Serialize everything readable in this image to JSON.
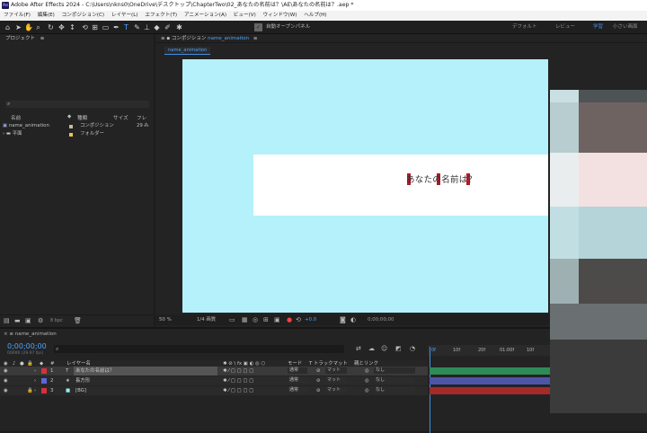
{
  "titlebar": {
    "icon_text": "Ae",
    "title": "Adobe After Effects 2024 - C:\\Users\\nkns0\\OneDrive\\デスクトップ\\ChapterTwo\\02_あなたの名前は？\\AE\\あなたの名前は？.aep *"
  },
  "menu": [
    "ファイル(F)",
    "編集(E)",
    "コンポジション(C)",
    "レイヤー(L)",
    "エフェクト(T)",
    "アニメーション(A)",
    "ビュー(V)",
    "ウィンドウ(W)",
    "ヘルプ(H)"
  ],
  "toolbar": {
    "auto_open_label": "自動オープンパネル",
    "workspaces": [
      "デフォルト",
      "レビュー",
      "学習",
      "小さい画面"
    ],
    "active_workspace": "学習"
  },
  "project": {
    "title": "プロジェクト",
    "columns": {
      "name": "名前",
      "type": "種類",
      "size": "サイズ",
      "fr": "フレ"
    },
    "items": [
      {
        "name": "name_animation",
        "type": "コンポジション",
        "size": "29",
        "color": "#c8b89a"
      },
      {
        "name": "平面",
        "type": "フォルダー",
        "size": "",
        "color": "#e8c84a"
      }
    ],
    "bpc": "8 bpc"
  },
  "comp": {
    "panel_title": "コンポジション",
    "comp_name": "name_animation",
    "tab": "name_animation",
    "text": "あなたの名前は？",
    "footer": {
      "zoom": "50 %",
      "resolution": "1/4 画質",
      "exposure": "+0.0",
      "timecode": "0;00;00;00"
    },
    "bg_color": "#b4f1fb"
  },
  "timeline": {
    "comp_tab": "name_animation",
    "timecode": "0;00;00;00",
    "frame_info": "00000 (29.97 fps)",
    "headers": {
      "layer_name": "レイヤー名",
      "mode": "モード",
      "track": "T トラックマット",
      "parent": "親とリンク"
    },
    "layers": [
      {
        "num": "1",
        "type": "T",
        "name": "あなたの名前は？",
        "mode": "通常",
        "matte": "マット",
        "parent": "なし",
        "label": "#d6313d",
        "bar": "#2e8b57"
      },
      {
        "num": "2",
        "type": "★",
        "name": "長方形",
        "mode": "通常",
        "matte": "マット",
        "parent": "なし",
        "label": "#5f66d8",
        "bar": "#4e54a8"
      },
      {
        "num": "3",
        "type": "■",
        "name": "[BG]",
        "mode": "通常",
        "matte": "マット",
        "parent": "なし",
        "label": "#d6313d",
        "bar": "#a52a2a"
      }
    ],
    "ruler": [
      "0f",
      "10f",
      "20f",
      "01:00f",
      "10f"
    ]
  }
}
